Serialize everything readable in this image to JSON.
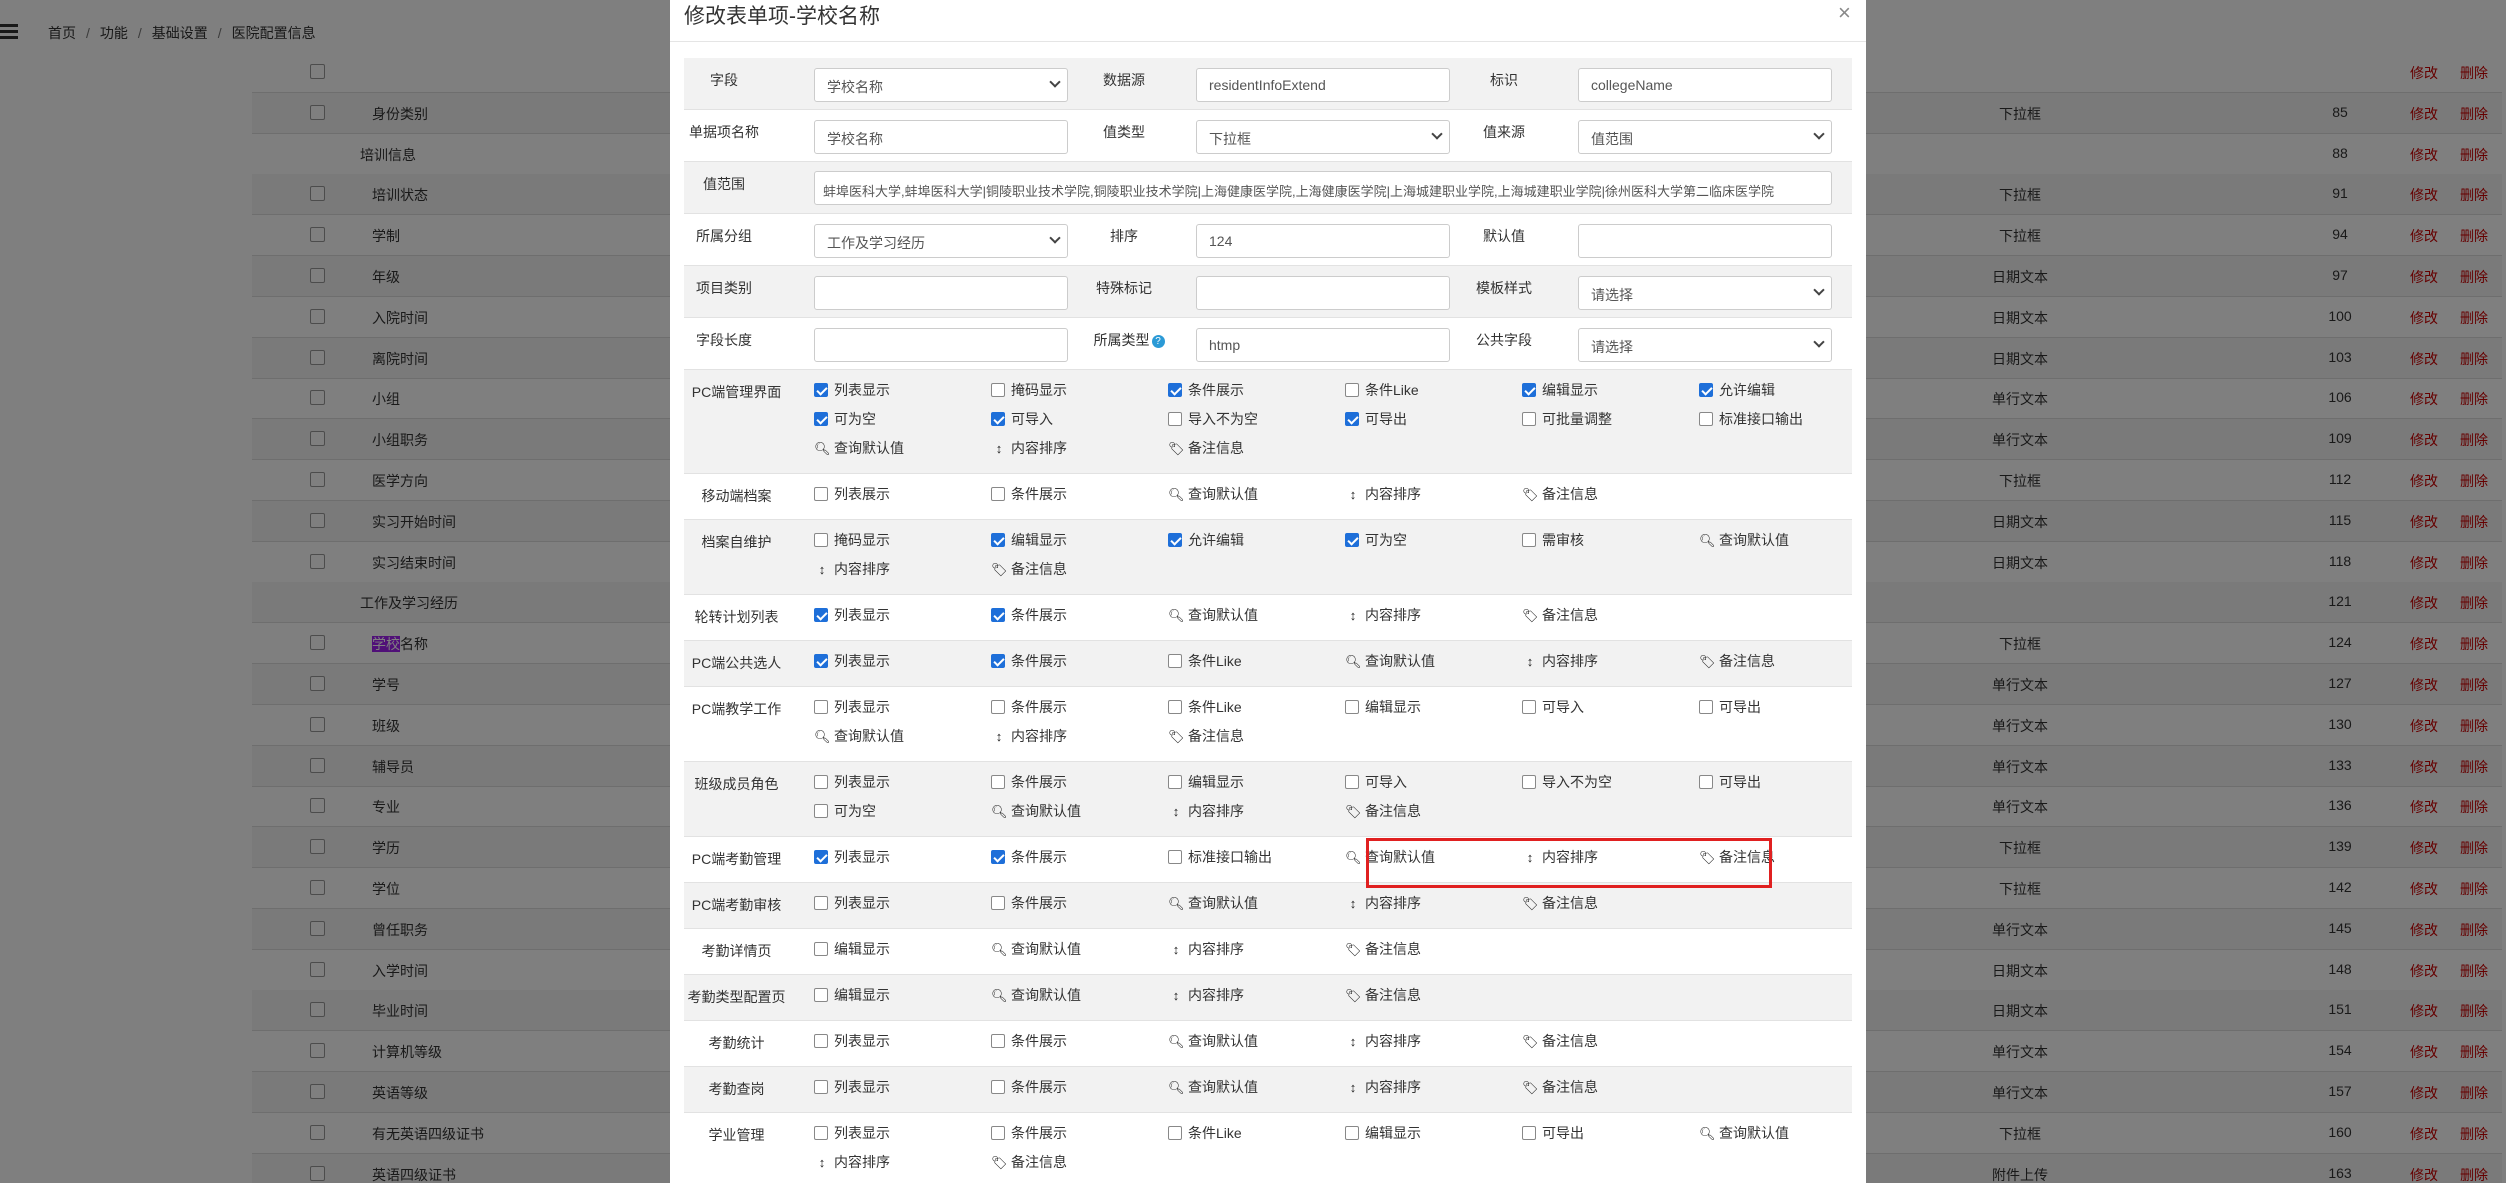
{
  "breadcrumb": {
    "home": "首页",
    "func": "功能",
    "base": "基础设置",
    "current": "医院配置信息"
  },
  "background_rows": [
    {
      "name": "",
      "type": "",
      "num": "",
      "hasCb": true
    },
    {
      "name": "身份类别",
      "type": "下拉框",
      "num": "85",
      "hasCb": true
    },
    {
      "name": "培训信息",
      "type": "",
      "num": "88",
      "hasCb": false
    },
    {
      "name": "培训状态",
      "type": "下拉框",
      "num": "91",
      "hasCb": true
    },
    {
      "name": "学制",
      "type": "下拉框",
      "num": "94",
      "hasCb": true
    },
    {
      "name": "年级",
      "type": "日期文本",
      "num": "97",
      "hasCb": true
    },
    {
      "name": "入院时间",
      "type": "日期文本",
      "num": "100",
      "hasCb": true
    },
    {
      "name": "离院时间",
      "type": "日期文本",
      "num": "103",
      "hasCb": true
    },
    {
      "name": "小组",
      "type": "单行文本",
      "num": "106",
      "hasCb": true
    },
    {
      "name": "小组职务",
      "type": "单行文本",
      "num": "109",
      "hasCb": true
    },
    {
      "name": "医学方向",
      "type": "下拉框",
      "num": "112",
      "hasCb": true
    },
    {
      "name": "实习开始时间",
      "type": "日期文本",
      "num": "115",
      "hasCb": true
    },
    {
      "name": "实习结束时间",
      "type": "日期文本",
      "num": "118",
      "hasCb": true
    },
    {
      "name": "工作及学习经历",
      "type": "",
      "num": "121",
      "hasCb": false
    },
    {
      "name": "学校名称",
      "type": "下拉框",
      "num": "124",
      "hasCb": true
    },
    {
      "name": "学号",
      "type": "单行文本",
      "num": "127",
      "hasCb": true
    },
    {
      "name": "班级",
      "type": "单行文本",
      "num": "130",
      "hasCb": true
    },
    {
      "name": "辅导员",
      "type": "单行文本",
      "num": "133",
      "hasCb": true
    },
    {
      "name": "专业",
      "type": "单行文本",
      "num": "136",
      "hasCb": true
    },
    {
      "name": "学历",
      "type": "下拉框",
      "num": "139",
      "hasCb": true
    },
    {
      "name": "学位",
      "type": "下拉框",
      "num": "142",
      "hasCb": true
    },
    {
      "name": "曾任职务",
      "type": "单行文本",
      "num": "145",
      "hasCb": true
    },
    {
      "name": "入学时间",
      "type": "日期文本",
      "num": "148",
      "hasCb": true
    },
    {
      "name": "毕业时间",
      "type": "日期文本",
      "num": "151",
      "hasCb": true
    },
    {
      "name": "计算机等级",
      "type": "单行文本",
      "num": "154",
      "hasCb": true
    },
    {
      "name": "英语等级",
      "type": "单行文本",
      "num": "157",
      "hasCb": true
    },
    {
      "name": "有无英语四级证书",
      "type": "下拉框",
      "num": "160",
      "hasCb": true
    },
    {
      "name": "英语四级证书",
      "type": "附件上传",
      "num": "163",
      "hasCb": true
    }
  ],
  "bg_actions": {
    "edit": "修改",
    "delete": "删除"
  },
  "highlight_text": {
    "hl": "学校",
    "rest": "名称"
  },
  "modal": {
    "title": "修改表单项-学校名称",
    "close": "×",
    "fields": {
      "field_label": "字段",
      "field_value": "学校名称",
      "datasource_label": "数据源",
      "datasource_value": "residentInfoExtend",
      "identifier_label": "标识",
      "identifier_value": "collegeName",
      "itemname_label": "单据项名称",
      "itemname_value": "学校名称",
      "valuetype_label": "值类型",
      "valuetype_value": "下拉框",
      "valuesource_label": "值来源",
      "valuesource_value": "值范围",
      "range_label": "值范围",
      "range_value": "蚌埠医科大学,蚌埠医科大学|铜陵职业技术学院,铜陵职业技术学院|上海健康医学院,上海健康医学院|上海城建职业学院,上海城建职业学院|徐州医科大学第二临床医学院",
      "group_label": "所属分组",
      "group_value": "工作及学习经历",
      "sort_label": "排序",
      "sort_value": "124",
      "default_label": "默认值",
      "default_value": "",
      "category_label": "项目类别",
      "category_value": "",
      "special_label": "特殊标记",
      "special_value": "",
      "template_label": "模板样式",
      "template_value": "请选择",
      "length_label": "字段长度",
      "length_value": "",
      "belongtype_label": "所属类型",
      "belongtype_value": "htmp",
      "public_label": "公共字段",
      "public_value": "请选择"
    },
    "perm_rows": [
      {
        "label": "PC端管理界面",
        "items": [
          {
            "kind": "cb",
            "on": true,
            "text": "列表显示"
          },
          {
            "kind": "cb",
            "on": false,
            "text": "掩码显示"
          },
          {
            "kind": "cb",
            "on": true,
            "text": "条件展示"
          },
          {
            "kind": "cb",
            "on": false,
            "text": "条件Like"
          },
          {
            "kind": "cb",
            "on": true,
            "text": "编辑显示"
          },
          {
            "kind": "cb",
            "on": true,
            "text": "允许编辑"
          },
          {
            "kind": "cb",
            "on": true,
            "text": "可为空"
          },
          {
            "kind": "cb",
            "on": true,
            "text": "可导入"
          },
          {
            "kind": "cb",
            "on": false,
            "text": "导入不为空"
          },
          {
            "kind": "cb",
            "on": true,
            "text": "可导出"
          },
          {
            "kind": "cb",
            "on": false,
            "text": "可批量调整"
          },
          {
            "kind": "cb",
            "on": false,
            "text": "标准接口输出"
          },
          {
            "kind": "search",
            "text": "查询默认值"
          },
          {
            "kind": "sort",
            "text": "内容排序"
          },
          {
            "kind": "tag",
            "text": "备注信息"
          }
        ]
      },
      {
        "label": "移动端档案",
        "items": [
          {
            "kind": "cb",
            "on": false,
            "text": "列表展示"
          },
          {
            "kind": "cb",
            "on": false,
            "text": "条件展示"
          },
          {
            "kind": "search",
            "text": "查询默认值"
          },
          {
            "kind": "sort",
            "text": "内容排序"
          },
          {
            "kind": "tag",
            "text": "备注信息"
          }
        ]
      },
      {
        "label": "档案自维护",
        "items": [
          {
            "kind": "cb",
            "on": false,
            "text": "掩码显示"
          },
          {
            "kind": "cb",
            "on": true,
            "text": "编辑显示"
          },
          {
            "kind": "cb",
            "on": true,
            "text": "允许编辑"
          },
          {
            "kind": "cb",
            "on": true,
            "text": "可为空"
          },
          {
            "kind": "cb",
            "on": false,
            "text": "需审核"
          },
          {
            "kind": "search",
            "text": "查询默认值"
          },
          {
            "kind": "sort",
            "text": "内容排序"
          },
          {
            "kind": "tag",
            "text": "备注信息"
          }
        ]
      },
      {
        "label": "轮转计划列表",
        "items": [
          {
            "kind": "cb",
            "on": true,
            "text": "列表显示"
          },
          {
            "kind": "cb",
            "on": true,
            "text": "条件展示"
          },
          {
            "kind": "search",
            "text": "查询默认值"
          },
          {
            "kind": "sort",
            "text": "内容排序"
          },
          {
            "kind": "tag",
            "text": "备注信息"
          }
        ]
      },
      {
        "label": "PC端公共选人",
        "items": [
          {
            "kind": "cb",
            "on": true,
            "text": "列表显示"
          },
          {
            "kind": "cb",
            "on": true,
            "text": "条件展示"
          },
          {
            "kind": "cb",
            "on": false,
            "text": "条件Like"
          },
          {
            "kind": "search",
            "text": "查询默认值"
          },
          {
            "kind": "sort",
            "text": "内容排序"
          },
          {
            "kind": "tag",
            "text": "备注信息"
          }
        ]
      },
      {
        "label": "PC端教学工作",
        "items": [
          {
            "kind": "cb",
            "on": false,
            "text": "列表显示"
          },
          {
            "kind": "cb",
            "on": false,
            "text": "条件展示"
          },
          {
            "kind": "cb",
            "on": false,
            "text": "条件Like"
          },
          {
            "kind": "cb",
            "on": false,
            "text": "编辑显示"
          },
          {
            "kind": "cb",
            "on": false,
            "text": "可导入"
          },
          {
            "kind": "cb",
            "on": false,
            "text": "可导出"
          },
          {
            "kind": "search",
            "text": "查询默认值"
          },
          {
            "kind": "sort",
            "text": "内容排序"
          },
          {
            "kind": "tag",
            "text": "备注信息"
          }
        ]
      },
      {
        "label": "班级成员角色",
        "items": [
          {
            "kind": "cb",
            "on": false,
            "text": "列表显示"
          },
          {
            "kind": "cb",
            "on": false,
            "text": "条件展示"
          },
          {
            "kind": "cb",
            "on": false,
            "text": "编辑显示"
          },
          {
            "kind": "cb",
            "on": false,
            "text": "可导入"
          },
          {
            "kind": "cb",
            "on": false,
            "text": "导入不为空"
          },
          {
            "kind": "cb",
            "on": false,
            "text": "可导出"
          },
          {
            "kind": "cb",
            "on": false,
            "text": "可为空"
          },
          {
            "kind": "search",
            "text": "查询默认值"
          },
          {
            "kind": "sort",
            "text": "内容排序"
          },
          {
            "kind": "tag",
            "text": "备注信息"
          }
        ]
      },
      {
        "label": "PC端考勤管理",
        "items": [
          {
            "kind": "cb",
            "on": true,
            "text": "列表显示"
          },
          {
            "kind": "cb",
            "on": true,
            "text": "条件展示"
          },
          {
            "kind": "cb",
            "on": false,
            "text": "标准接口输出"
          },
          {
            "kind": "search",
            "text": "查询默认值"
          },
          {
            "kind": "sort",
            "text": "内容排序"
          },
          {
            "kind": "tag",
            "text": "备注信息"
          }
        ]
      },
      {
        "label": "PC端考勤审核",
        "items": [
          {
            "kind": "cb",
            "on": false,
            "text": "列表显示"
          },
          {
            "kind": "cb",
            "on": false,
            "text": "条件展示"
          },
          {
            "kind": "search",
            "text": "查询默认值"
          },
          {
            "kind": "sort",
            "text": "内容排序"
          },
          {
            "kind": "tag",
            "text": "备注信息"
          }
        ]
      },
      {
        "label": "考勤详情页",
        "items": [
          {
            "kind": "cb",
            "on": false,
            "text": "编辑显示"
          },
          {
            "kind": "search",
            "text": "查询默认值"
          },
          {
            "kind": "sort",
            "text": "内容排序"
          },
          {
            "kind": "tag",
            "text": "备注信息"
          }
        ]
      },
      {
        "label": "考勤类型配置页",
        "items": [
          {
            "kind": "cb",
            "on": false,
            "text": "编辑显示"
          },
          {
            "kind": "search",
            "text": "查询默认值"
          },
          {
            "kind": "sort",
            "text": "内容排序"
          },
          {
            "kind": "tag",
            "text": "备注信息"
          }
        ]
      },
      {
        "label": "考勤统计",
        "items": [
          {
            "kind": "cb",
            "on": false,
            "text": "列表显示"
          },
          {
            "kind": "cb",
            "on": false,
            "text": "条件展示"
          },
          {
            "kind": "search",
            "text": "查询默认值"
          },
          {
            "kind": "sort",
            "text": "内容排序"
          },
          {
            "kind": "tag",
            "text": "备注信息"
          }
        ]
      },
      {
        "label": "考勤查岗",
        "items": [
          {
            "kind": "cb",
            "on": false,
            "text": "列表显示"
          },
          {
            "kind": "cb",
            "on": false,
            "text": "条件展示"
          },
          {
            "kind": "search",
            "text": "查询默认值"
          },
          {
            "kind": "sort",
            "text": "内容排序"
          },
          {
            "kind": "tag",
            "text": "备注信息"
          }
        ]
      },
      {
        "label": "学业管理",
        "items": [
          {
            "kind": "cb",
            "on": false,
            "text": "列表显示"
          },
          {
            "kind": "cb",
            "on": false,
            "text": "条件展示"
          },
          {
            "kind": "cb",
            "on": false,
            "text": "条件Like"
          },
          {
            "kind": "cb",
            "on": false,
            "text": "编辑显示"
          },
          {
            "kind": "cb",
            "on": false,
            "text": "可导出"
          },
          {
            "kind": "search",
            "text": "查询默认值"
          },
          {
            "kind": "sort",
            "text": "内容排序"
          },
          {
            "kind": "tag",
            "text": "备注信息"
          }
        ]
      }
    ]
  },
  "colors": {
    "checked": "#1e6fd9",
    "highlight_box": "#e02020",
    "delete_link": "#c00000",
    "search_highlight": "#a020f0"
  }
}
